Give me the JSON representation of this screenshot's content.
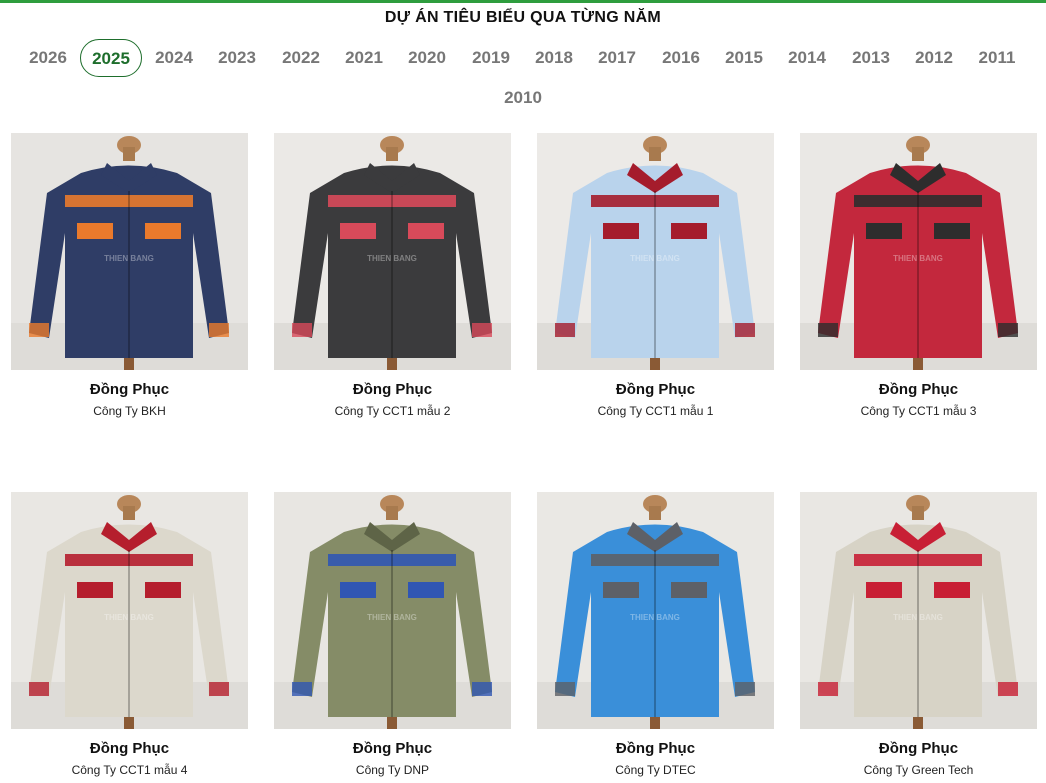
{
  "header": {
    "title": "DỰ ÁN TIÊU BIỂU QUA TỪNG NĂM"
  },
  "years": [
    "2026",
    "2025",
    "2024",
    "2023",
    "2022",
    "2021",
    "2020",
    "2019",
    "2018",
    "2017",
    "2016",
    "2015",
    "2014",
    "2013",
    "2012",
    "2011",
    "2010"
  ],
  "active_year": "2025",
  "projects": [
    {
      "title": "Đồng Phục",
      "subtitle": "Công Ty BKH",
      "colors": {
        "body": "#2f3d66",
        "accent": "#ea7a2c",
        "collar": "#2f3d66",
        "bg": "#e6e4e1"
      }
    },
    {
      "title": "Đồng Phục",
      "subtitle": "Công Ty CCT1 mẫu 2",
      "colors": {
        "body": "#3b3b3d",
        "accent": "#d84a5a",
        "collar": "#3b3b3d",
        "bg": "#ebe9e6"
      }
    },
    {
      "title": "Đồng Phục",
      "subtitle": "Công Ty CCT1 mẫu 1",
      "colors": {
        "body": "#b9d3ec",
        "accent": "#a51c2c",
        "collar": "#a51c2c",
        "bg": "#eceae7"
      }
    },
    {
      "title": "Đồng Phục",
      "subtitle": "Công Ty CCT1 mẫu 3",
      "colors": {
        "body": "#c3283d",
        "accent": "#2d2d2d",
        "collar": "#2d2d2d",
        "bg": "#eae8e5"
      }
    },
    {
      "title": "Đồng Phục",
      "subtitle": "Công Ty CCT1 mẫu 4",
      "colors": {
        "body": "#dcd8cc",
        "accent": "#b51e2d",
        "collar": "#b51e2d",
        "bg": "#e9e7e3"
      }
    },
    {
      "title": "Đồng Phục",
      "subtitle": "Công Ty DNP",
      "colors": {
        "body": "#858c67",
        "accent": "#3056b3",
        "collar": "#5e6447",
        "bg": "#e8e6e2"
      }
    },
    {
      "title": "Đồng Phục",
      "subtitle": "Công Ty DTEC",
      "colors": {
        "body": "#3a8fd9",
        "accent": "#5d6067",
        "collar": "#5d6067",
        "bg": "#eae8e4"
      }
    },
    {
      "title": "Đồng Phục",
      "subtitle": "Công Ty Green Tech",
      "colors": {
        "body": "#d7d3c6",
        "accent": "#c81f35",
        "collar": "#c81f35",
        "bg": "#e9e7e3"
      }
    }
  ]
}
